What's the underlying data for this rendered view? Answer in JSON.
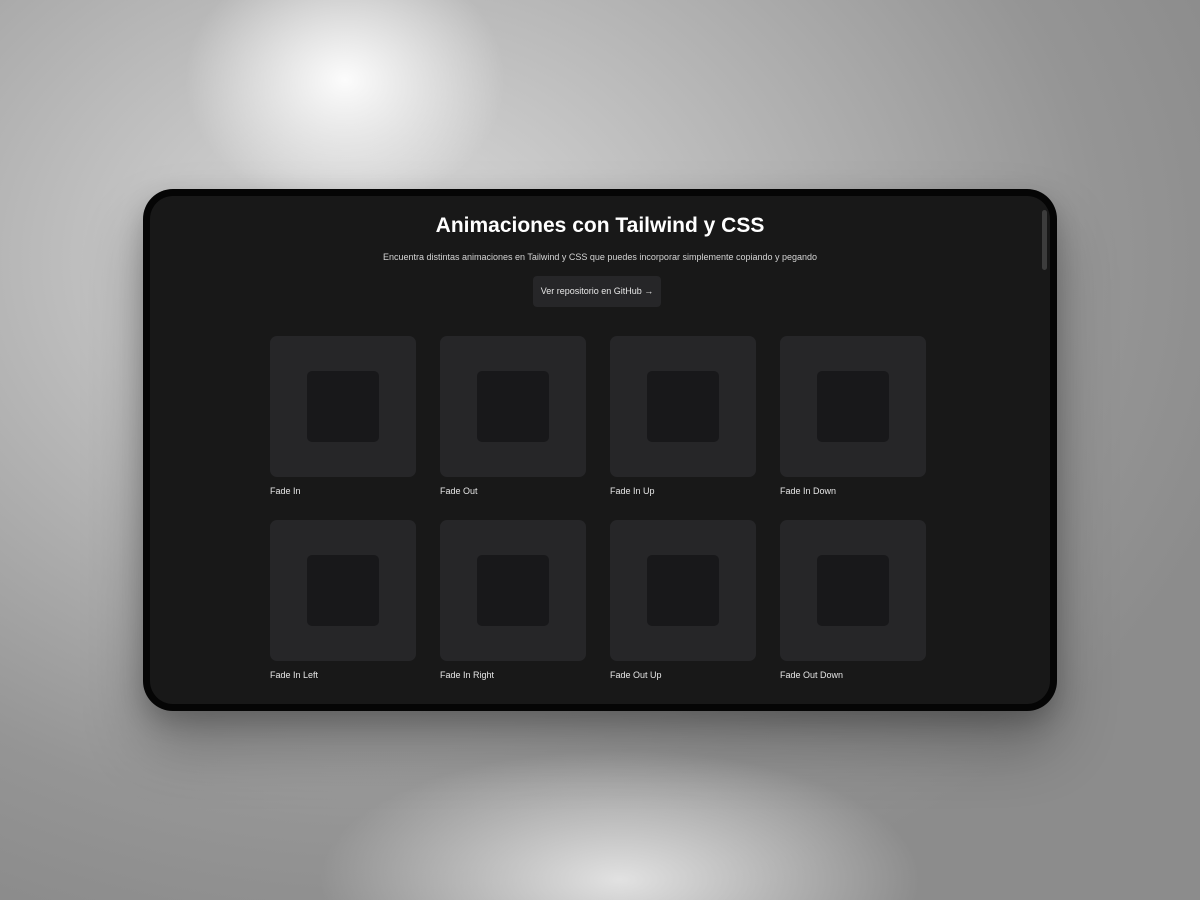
{
  "page": {
    "title": "Animaciones con Tailwind y CSS",
    "subtitle": "Encuentra distintas animaciones en Tailwind y CSS que puedes incorporar simplemente copiando y pegando",
    "github_button": "Ver repositorio en GitHub →"
  },
  "animations": [
    {
      "label": "Fade In"
    },
    {
      "label": "Fade Out"
    },
    {
      "label": "Fade In Up"
    },
    {
      "label": "Fade In Down"
    },
    {
      "label": "Fade In Left"
    },
    {
      "label": "Fade In Right"
    },
    {
      "label": "Fade Out Up"
    },
    {
      "label": "Fade Out Down"
    }
  ],
  "colors": {
    "screen_background": "#181818",
    "card_background": "#262628",
    "card_inner": "#18181a",
    "text": "#ffffff"
  }
}
